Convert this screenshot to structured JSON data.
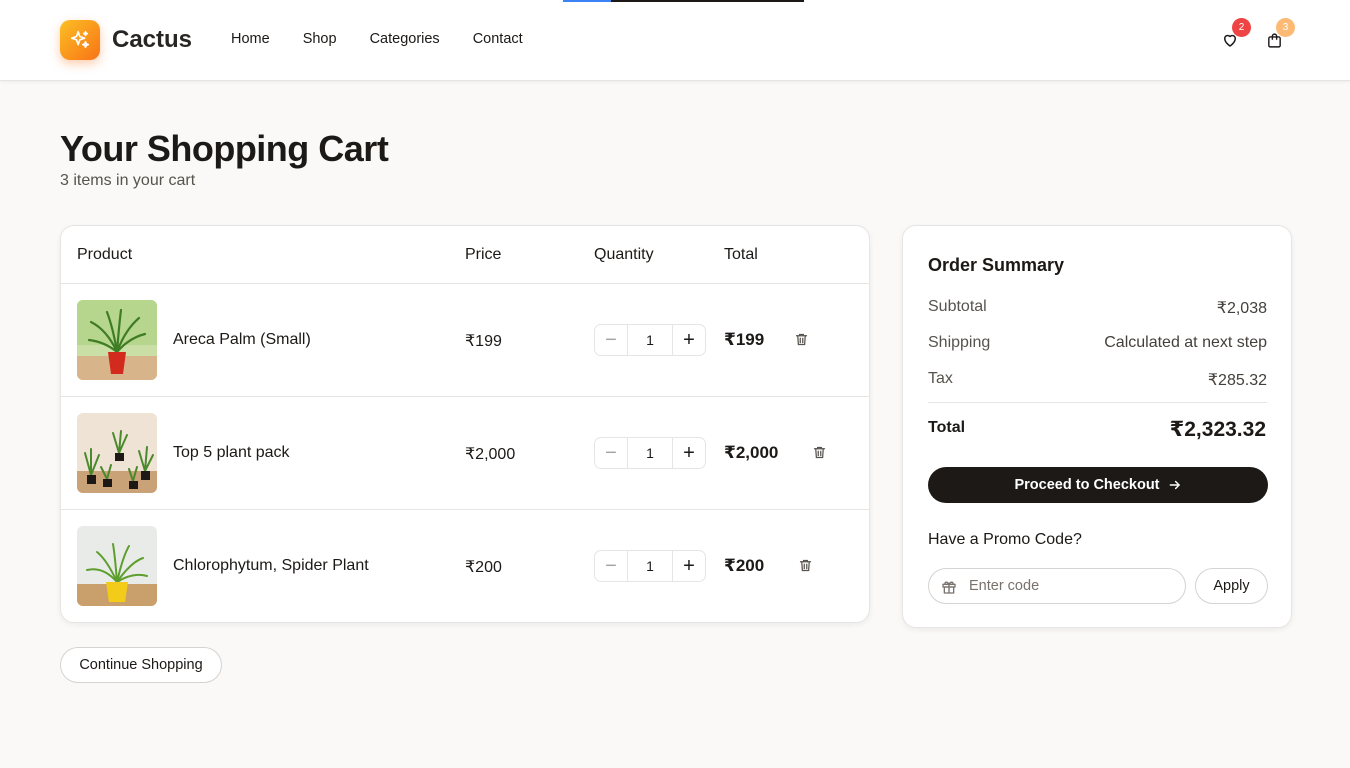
{
  "header": {
    "brand": "Cactus",
    "nav": [
      {
        "label": "Home"
      },
      {
        "label": "Shop"
      },
      {
        "label": "Categories"
      },
      {
        "label": "Contact"
      }
    ],
    "wishlist_count": "2",
    "cart_count": "3",
    "icons": {
      "logo": "sparkle-icon",
      "wishlist": "heart-icon",
      "cart": "shopping-bag-icon"
    },
    "colors": {
      "logo_gradient_start": "#fbbf24",
      "logo_gradient_end": "#f97316",
      "wishlist_badge": "#ef4444",
      "cart_badge": "#fdba74"
    }
  },
  "page": {
    "title": "Your Shopping Cart",
    "subtitle": "3 items in your cart"
  },
  "cart": {
    "columns": {
      "product": "Product",
      "price": "Price",
      "quantity": "Quantity",
      "total": "Total"
    },
    "items": [
      {
        "name": "Areca Palm (Small)",
        "price": "₹199",
        "quantity": "1",
        "total": "₹199"
      },
      {
        "name": "Top 5 plant pack",
        "price": "₹2,000",
        "quantity": "1",
        "total": "₹2,000"
      },
      {
        "name": "Chlorophytum, Spider Plant",
        "price": "₹200",
        "quantity": "1",
        "total": "₹200"
      }
    ],
    "continue_label": "Continue Shopping"
  },
  "summary": {
    "title": "Order Summary",
    "subtotal_label": "Subtotal",
    "subtotal_value": "₹2,038",
    "shipping_label": "Shipping",
    "shipping_value": "Calculated at next step",
    "tax_label": "Tax",
    "tax_value": "₹285.32",
    "total_label": "Total",
    "total_value": "₹2,323.32",
    "checkout_label": "Proceed to Checkout",
    "promo_title": "Have a Promo Code?",
    "promo_placeholder": "Enter code",
    "apply_label": "Apply",
    "colors": {
      "checkout_bg": "#1c1917"
    }
  }
}
